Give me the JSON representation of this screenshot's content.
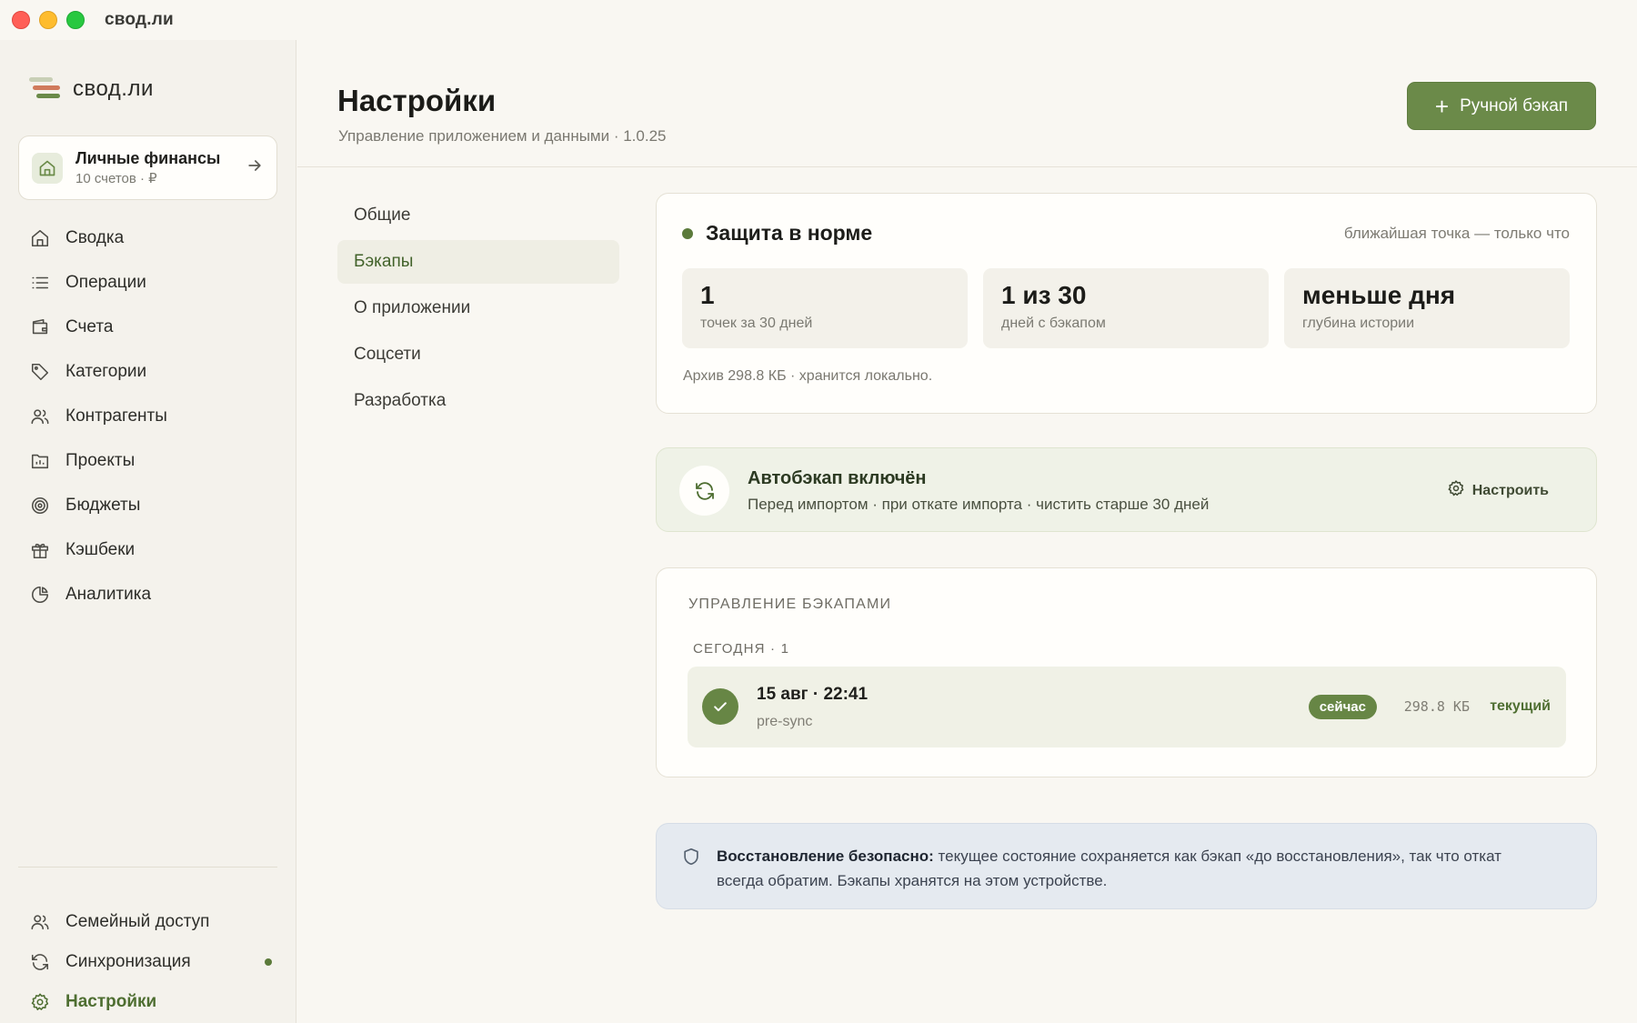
{
  "window": {
    "title": "свод.ли"
  },
  "sidebar": {
    "brand": "свод.ли",
    "workspace": {
      "title": "Личные финансы",
      "subtitle": "10 счетов · ₽"
    },
    "items": [
      {
        "label": "Сводка",
        "icon": "home-icon"
      },
      {
        "label": "Операции",
        "icon": "list-icon"
      },
      {
        "label": "Счета",
        "icon": "wallet-icon"
      },
      {
        "label": "Категории",
        "icon": "tag-icon"
      },
      {
        "label": "Контрагенты",
        "icon": "users-icon"
      },
      {
        "label": "Проекты",
        "icon": "folder-chart-icon"
      },
      {
        "label": "Бюджеты",
        "icon": "target-icon"
      },
      {
        "label": "Кэшбеки",
        "icon": "gift-icon"
      },
      {
        "label": "Аналитика",
        "icon": "pie-chart-icon"
      }
    ],
    "bottom_items": [
      {
        "label": "Семейный доступ",
        "icon": "users-icon"
      },
      {
        "label": "Синхронизация",
        "icon": "sync-icon"
      },
      {
        "label": "Настройки",
        "icon": "gear-icon"
      }
    ]
  },
  "header": {
    "title": "Настройки",
    "subtitle": "Управление приложением и данными · 1.0.25",
    "primary_button": "Ручной бэкап"
  },
  "subnav": {
    "items": [
      "Общие",
      "Бэкапы",
      "О приложении",
      "Соцсети",
      "Разработка"
    ],
    "active": "Бэкапы"
  },
  "status": {
    "title": "Защита в норме",
    "nearest": "ближайшая точка — только что",
    "stats": [
      {
        "value": "1",
        "label": "точек за 30 дней"
      },
      {
        "value": "1 из 30",
        "label": "дней с бэкапом"
      },
      {
        "value": "меньше дня",
        "label": "глубина истории"
      }
    ],
    "archive": "Архив 298.8 КБ · хранится локально."
  },
  "autobackup": {
    "title": "Автобэкап включён",
    "subtitle": "Перед импортом · при откате импорта · чистить старше 30 дней",
    "button": "Настроить"
  },
  "manage": {
    "title": "УПРАВЛЕНИЕ БЭКАПАМИ",
    "group_title": "СЕГОДНЯ · 1",
    "backups": [
      {
        "title": "15 авг · 22:41",
        "subtitle": "pre-sync",
        "badge": "сейчас",
        "size": "298.8 КБ",
        "status": "текущий"
      }
    ]
  },
  "info": {
    "bold": "Восстановление безопасно:",
    "text": " текущее состояние сохраняется как бэкап «до восстановления», так что откат всегда обратим. Бэкапы хранятся на этом устройстве."
  },
  "colors": {
    "accent": "#6b8a49",
    "background": "#f9f7f2",
    "info_bg": "#e5eaf0"
  }
}
